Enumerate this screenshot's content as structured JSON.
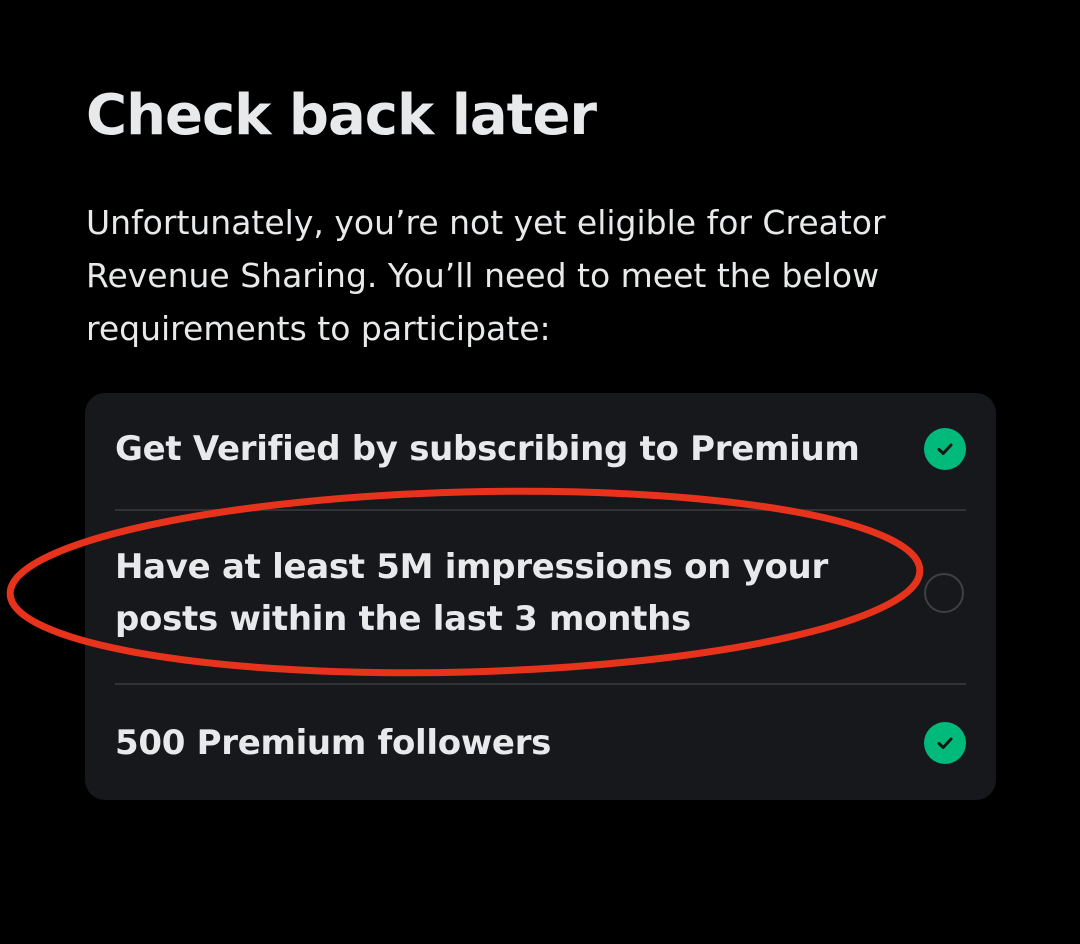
{
  "page": {
    "title": "Check back later",
    "description": "Unfortunately, you’re not yet eligible for Creator Revenue Sharing. You’ll need to meet the below requirements to participate:"
  },
  "requirements": [
    {
      "label": "Get Verified by subscribing to Premium",
      "met": true,
      "icon": "check-circle-icon"
    },
    {
      "label": "Have at least 5M impressions on your posts within the last 3 months",
      "met": false,
      "icon": "empty-circle-icon"
    },
    {
      "label": "500 Premium followers",
      "met": true,
      "icon": "check-circle-icon"
    }
  ],
  "colors": {
    "background": "#000000",
    "card": "#16181c",
    "text": "#e7e9ea",
    "divider": "#2f3336",
    "success": "#00ba7c",
    "annotation": "#e8331c"
  }
}
